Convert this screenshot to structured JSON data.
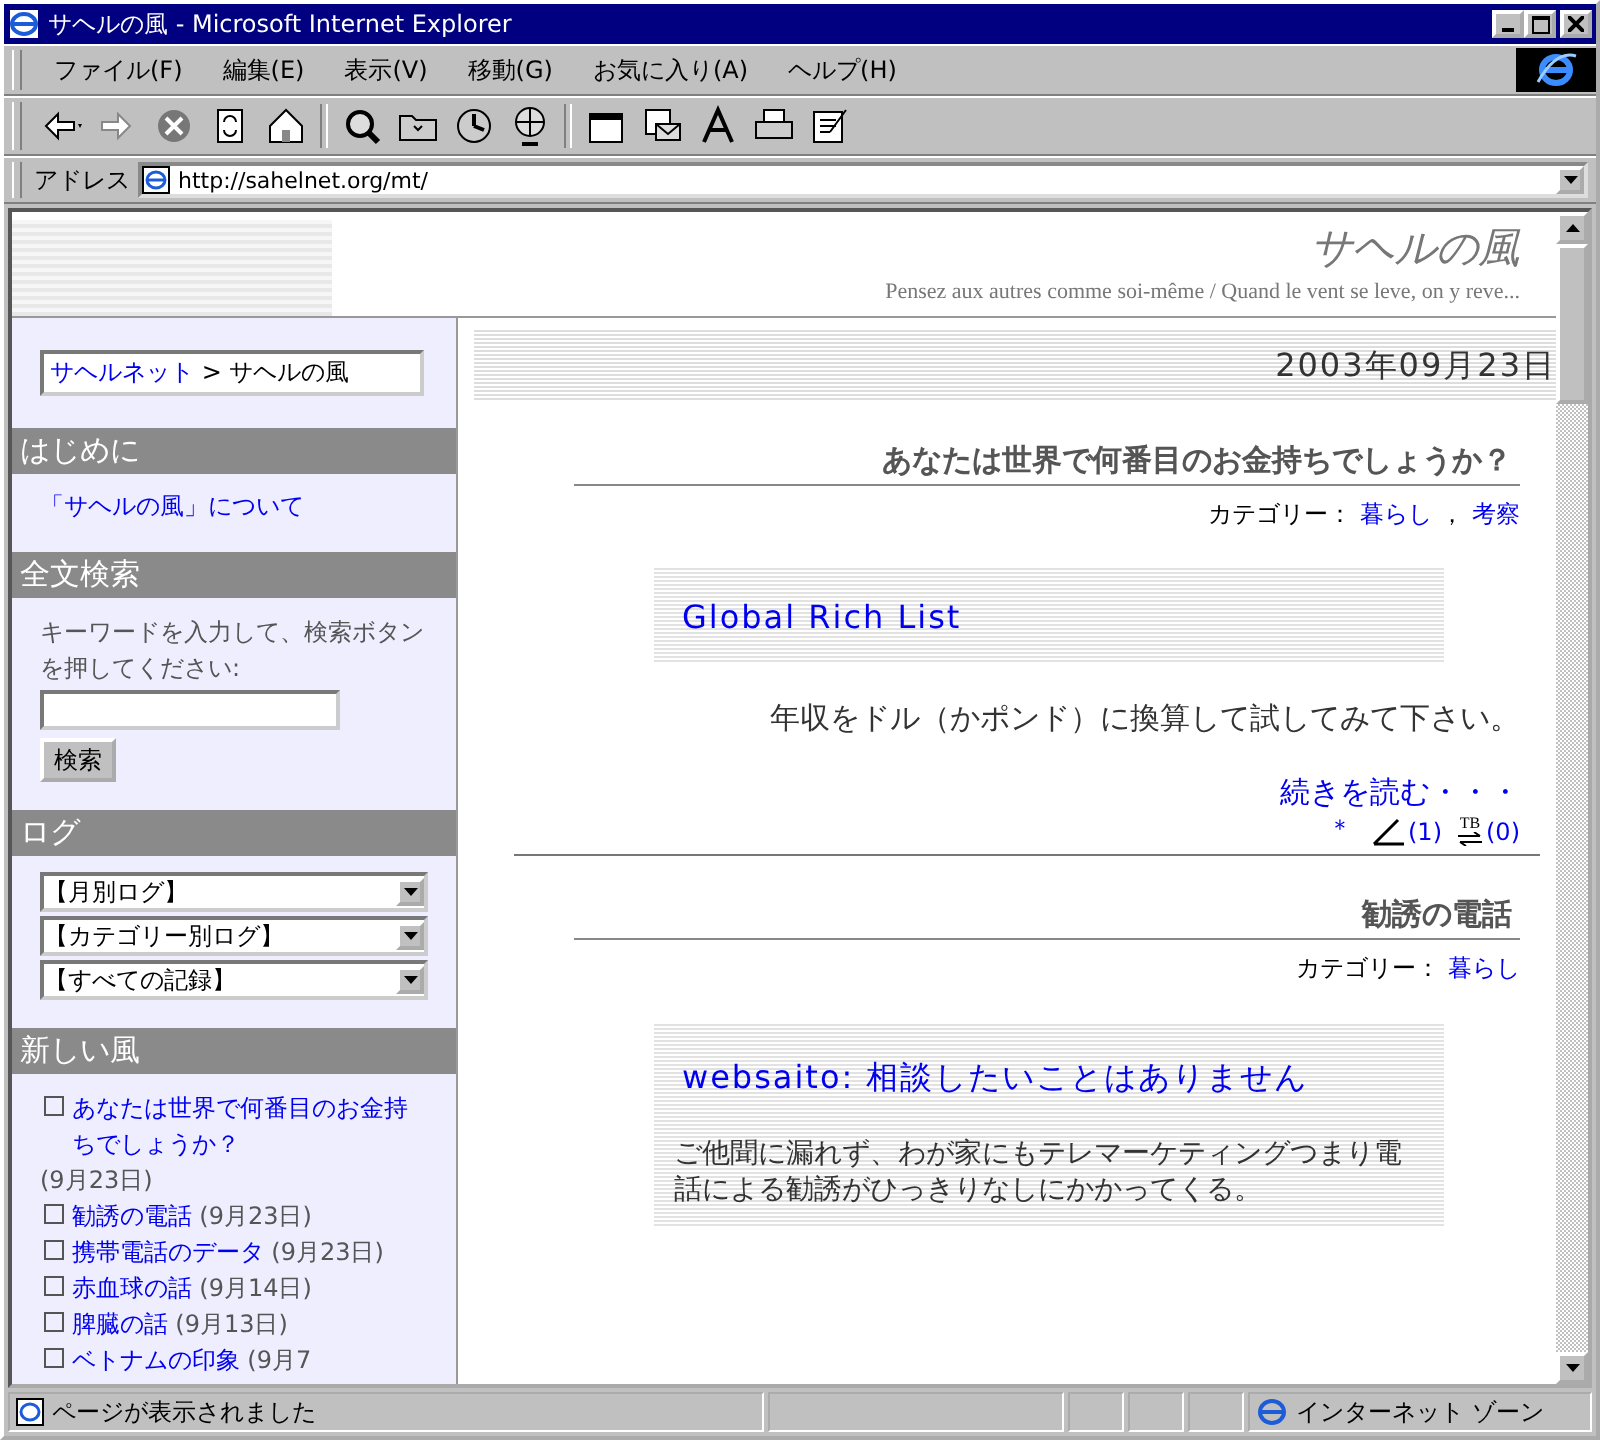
{
  "window": {
    "title": "サヘルの風 - Microsoft Internet Explorer"
  },
  "menu": [
    "ファイル(F)",
    "編集(E)",
    "表示(V)",
    "移動(G)",
    "お気に入り(A)",
    "ヘルプ(H)"
  ],
  "address": {
    "label": "アドレス",
    "value": "http://sahelnet.org/mt/"
  },
  "site": {
    "title": "サヘルの風",
    "tagline": "Pensez aux autres comme soi-même / Quand le vent se leve, on y reve..."
  },
  "sidebar": {
    "breadcrumb": {
      "link": "サヘルネット",
      "rest": "> サヘルの風"
    },
    "sections": [
      {
        "kind": "links",
        "heading": "はじめに",
        "links": [
          "「サヘルの風」について"
        ]
      },
      {
        "kind": "search",
        "heading": "全文検索",
        "text": "キーワードを入力して、検索ボタンを押してください:",
        "button": "検索"
      },
      {
        "kind": "selects",
        "heading": "ログ",
        "selects": [
          "【月別ログ】",
          "【カテゴリー別ログ】",
          "【すべての記録】"
        ]
      },
      {
        "kind": "recent",
        "heading": "新しい風",
        "items": [
          {
            "title": "あなたは世界で何番目のお金持ちでしょうか？",
            "date": "(9月23日)"
          },
          {
            "title": "勧誘の電話",
            "date": "(9月23日)"
          },
          {
            "title": "携帯電話のデータ",
            "date": "(9月23日)"
          },
          {
            "title": "赤血球の話",
            "date": "(9月14日)"
          },
          {
            "title": "脾臓の話",
            "date": "(9月13日)"
          },
          {
            "title": "ベトナムの印象",
            "date": "(9月7"
          }
        ]
      }
    ]
  },
  "main": {
    "date": "2003年09月23日",
    "entries": [
      {
        "title": "あなたは世界で何番目のお金持ちでしょうか？",
        "category_label": "カテゴリー：",
        "categories": [
          "暮らし",
          "考察"
        ],
        "separator": "，",
        "quote_title": "Global Rich List",
        "body": "年収をドル（かポンド）に換算して試してみて下さい。",
        "read_more": "続きを読む・・・",
        "mark": "＊",
        "comments": "(1)",
        "tb_label": "TB",
        "trackbacks": "(0)"
      },
      {
        "title": "勧誘の電話",
        "category_label": "カテゴリー：",
        "categories": [
          "暮らし"
        ],
        "quote_title": "websaito: 相談したいことはありません",
        "quote_text": "ご他聞に漏れず、わが家にもテレマーケティングつまり電話による勧誘がひっきりなしにかかってくる。"
      }
    ]
  },
  "status_bar": {
    "text": "ページが表示されました",
    "zone": "インターネット ゾーン"
  }
}
